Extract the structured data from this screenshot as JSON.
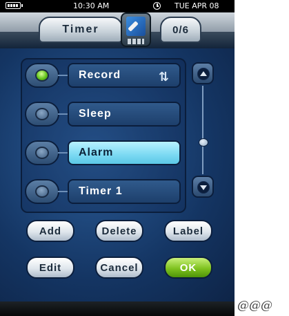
{
  "status_bar": {
    "battery_icon": "battery-icon",
    "time": "10:30 AM",
    "alarm_icon": "clock-icon",
    "date": "TUE APR 08"
  },
  "header": {
    "title": "Timer",
    "app_icon": "remote-settings-icon",
    "count": "0/6"
  },
  "timer_list": {
    "items": [
      {
        "label": "Record",
        "enabled": true,
        "icon": "repeat-icon",
        "selected": false
      },
      {
        "label": "Sleep",
        "enabled": false,
        "selected": false
      },
      {
        "label": "Alarm",
        "enabled": false,
        "selected": true
      },
      {
        "label": "Timer 1",
        "enabled": false,
        "selected": false
      }
    ],
    "repeat_glyph": "⇅"
  },
  "scrollbar": {
    "up_icon": "arrow-up-icon",
    "down_icon": "arrow-down-icon"
  },
  "actions": {
    "add": "Add",
    "delete": "Delete",
    "label": "Label",
    "edit": "Edit",
    "cancel": "Cancel",
    "ok": "OK"
  },
  "footer_text": "@@@",
  "colors": {
    "accent_green": "#7fc21f",
    "selected_blue": "#7bd9f2",
    "panel_blue": "#143563"
  }
}
